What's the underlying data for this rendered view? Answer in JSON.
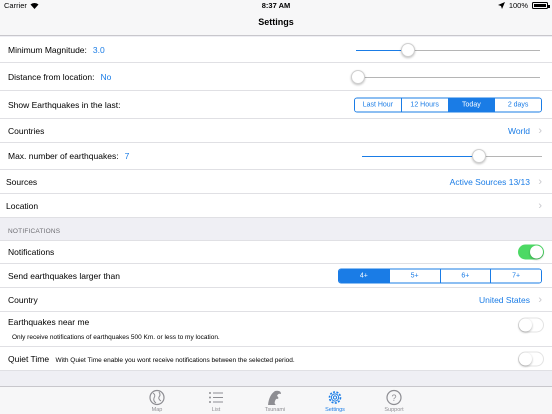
{
  "status": {
    "carrier": "Carrier",
    "time": "8:37 AM",
    "battery": "100%"
  },
  "nav": {
    "title": "Settings"
  },
  "settings": {
    "min_magnitude": {
      "label": "Minimum Magnitude:",
      "value": "3.0",
      "slider_fraction": 0.28
    },
    "distance": {
      "label": "Distance from location:",
      "value": "No",
      "slider_fraction": 0.0
    },
    "show_last": {
      "label": "Show Earthquakes in the last:",
      "options": [
        "Last Hour",
        "12 Hours",
        "Today",
        "2 days"
      ],
      "selected": "Today"
    },
    "countries": {
      "label": "Countries",
      "value": "World"
    },
    "max_number": {
      "label": "Max. number of earthquakes:",
      "value": "7",
      "slider_fraction": 0.65
    },
    "sources": {
      "label": "Sources",
      "value": "Active Sources 13/13"
    },
    "location": {
      "label": "Location"
    }
  },
  "notifications_section": {
    "header": "NOTIFICATIONS",
    "notifications": {
      "label": "Notifications",
      "on": true
    },
    "larger_than": {
      "label": "Send earthquakes larger than",
      "options": [
        "4+",
        "5+",
        "6+",
        "7+"
      ],
      "selected": "4+"
    },
    "country": {
      "label": "Country",
      "value": "United States"
    },
    "near_me": {
      "label": "Earthquakes near me",
      "description": "Only receive notifications of earthquakes 500 Km. or less to my location.",
      "on": false
    },
    "quiet_time": {
      "label": "Quiet Time",
      "description": "With Quiet Time enable you wont receive notifications between the selected period.",
      "on": false
    }
  },
  "tabs": [
    {
      "label": "Map",
      "icon": "globe-icon"
    },
    {
      "label": "List",
      "icon": "list-icon"
    },
    {
      "label": "Tsunami",
      "icon": "wave-icon"
    },
    {
      "label": "Settings",
      "icon": "gear-icon",
      "active": true
    },
    {
      "label": "Support",
      "icon": "question-icon"
    }
  ],
  "colors": {
    "accent": "#1a7ce6",
    "toggle_on": "#4cd964"
  }
}
